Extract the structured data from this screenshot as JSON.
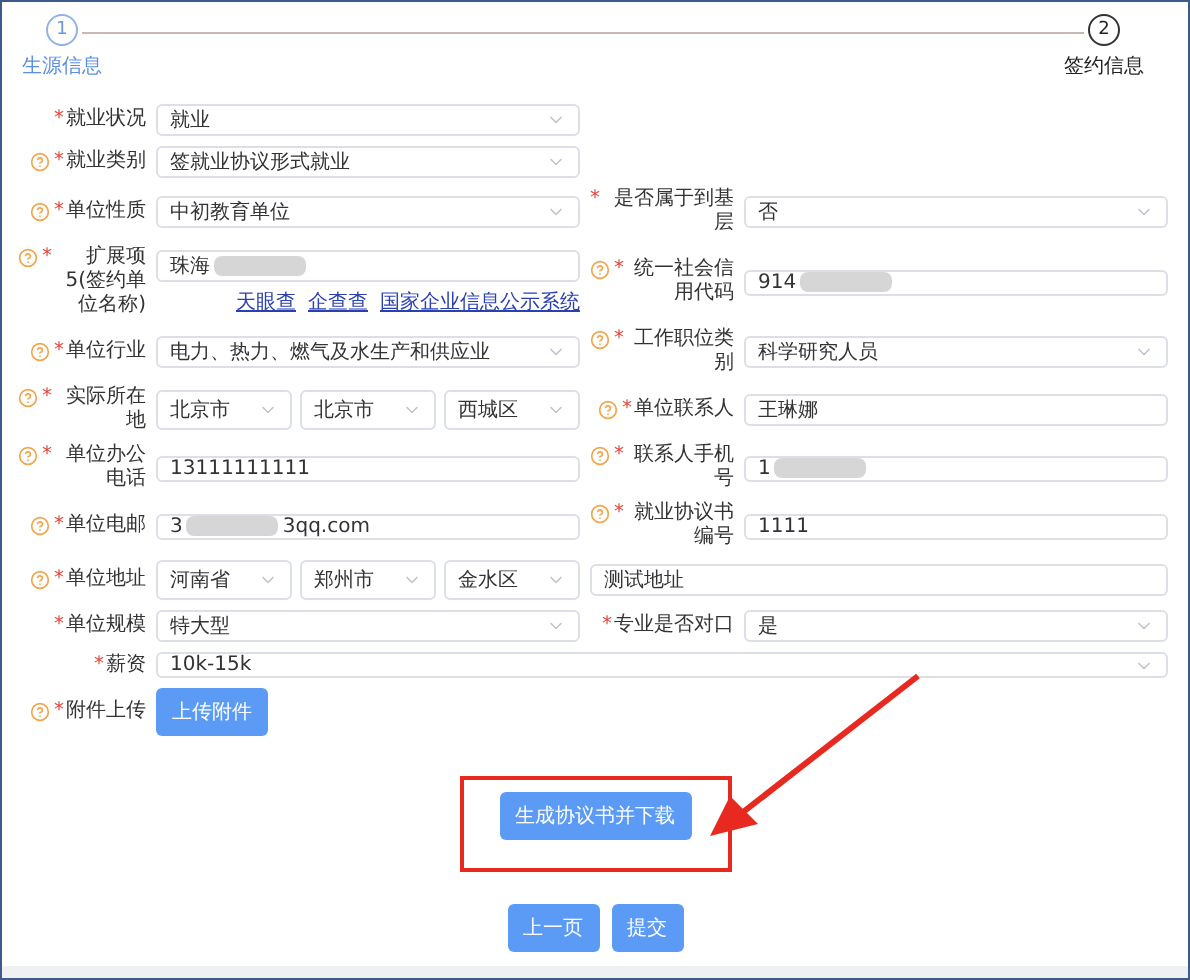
{
  "steps": [
    {
      "number": "1",
      "label": "生源信息",
      "selected": true
    },
    {
      "number": "2",
      "label": "签约信息",
      "selected": false
    }
  ],
  "rows": [
    {
      "fields": [
        {
          "label": "就业状况",
          "help": false,
          "mark": "*",
          "kind": "select",
          "value": "就业"
        }
      ]
    },
    {
      "fields": [
        {
          "label": "就业类别",
          "help": true,
          "mark": "*",
          "kind": "select",
          "value": "签就业协议形式就业"
        }
      ]
    },
    {
      "fields": [
        {
          "label": "单位性质",
          "help": true,
          "mark": "*",
          "kind": "select",
          "value": "中初教育单位"
        },
        {
          "label": "是否属于到基层",
          "help": false,
          "mark": "*",
          "kind": "select",
          "value": "否"
        }
      ]
    },
    {
      "fields": [
        {
          "label": "扩展项5(签约单位名称)",
          "help": true,
          "mark": "*",
          "kind": "input",
          "value": "珠海",
          "redacted": true,
          "links": [
            "天眼查",
            "企查查",
            "国家企业信息公示系统"
          ]
        },
        {
          "label": "统一社会信用代码",
          "help": true,
          "mark": "*",
          "kind": "input",
          "value": "914",
          "redacted": true
        }
      ]
    },
    {
      "fields": [
        {
          "label": "单位行业",
          "help": true,
          "mark": "*",
          "kind": "select",
          "value": "电力、热力、燃气及水生产和供应业"
        },
        {
          "label": "工作职位类别",
          "help": true,
          "mark": "*",
          "kind": "select",
          "value": "科学研究人员"
        }
      ]
    },
    {
      "fields": [
        {
          "label": "实际所在地",
          "help": true,
          "mark": "*",
          "kind": "region",
          "values": [
            "北京市",
            "北京市",
            "西城区"
          ]
        },
        {
          "label": "单位联系人",
          "help": true,
          "mark": "*",
          "kind": "input",
          "value": "王琳娜"
        }
      ]
    },
    {
      "fields": [
        {
          "label": "单位办公电话",
          "help": true,
          "mark": "*",
          "kind": "input",
          "value": "13111111111"
        },
        {
          "label": "联系人手机号",
          "help": true,
          "mark": "*",
          "kind": "input",
          "value": "1",
          "redacted": true
        }
      ]
    },
    {
      "fields": [
        {
          "label": "单位电邮",
          "help": true,
          "mark": "*",
          "kind": "input",
          "value": "3",
          "redacted": true,
          "value_end": "3qq.com"
        },
        {
          "label": "就业协议书编号",
          "help": true,
          "mark": "*",
          "kind": "input",
          "value": "1111"
        }
      ]
    },
    {
      "fields": [
        {
          "label": "单位地址",
          "help": true,
          "mark": "*",
          "kind": "address",
          "values": [
            "河南省",
            "郑州市",
            "金水区"
          ],
          "detail": "测试地址"
        }
      ]
    },
    {
      "fields": [
        {
          "label": "单位规模",
          "help": false,
          "mark": "*",
          "kind": "select",
          "value": "特大型"
        },
        {
          "label": "专业是否对口",
          "help": false,
          "mark": "*",
          "kind": "select",
          "value": "是"
        }
      ]
    },
    {
      "fields": [
        {
          "label": "薪资",
          "help": false,
          "mark": "*",
          "kind": "wide_select",
          "value": "10k-15k"
        }
      ]
    },
    {
      "fields": [
        {
          "label": "附件上传",
          "help": true,
          "mark": "*",
          "kind": "upload",
          "button": "上传附件"
        }
      ]
    }
  ],
  "generate_button": "生成协议书并下载",
  "buttons": [
    "上一页",
    "提交"
  ]
}
